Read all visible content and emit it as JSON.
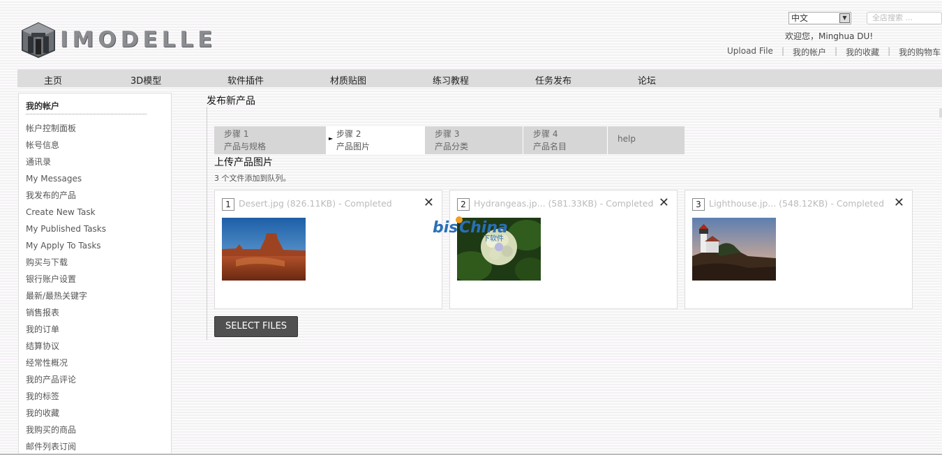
{
  "header": {
    "logo_text": "IMODELLE",
    "language": "中文",
    "search_placeholder": "全店搜索 ...",
    "welcome": "欢迎您，Minghua DU!",
    "links": [
      "Upload File",
      "我的帐户",
      "我的收藏",
      "我的购物车"
    ]
  },
  "nav": {
    "items": [
      "主页",
      "3D模型",
      "软件插件",
      "材质贴图",
      "练习教程",
      "任务发布",
      "论坛"
    ]
  },
  "sidebar": {
    "title": "我的帐户",
    "items": [
      "帐户控制面板",
      "帐号信息",
      "通讯录",
      "My Messages",
      "我发布的产品",
      "Create New Task",
      "My Published Tasks",
      "My Apply To Tasks",
      "购买与下载",
      "银行账户设置",
      "最新/最热关键字",
      "销售报表",
      "我的订单",
      "结算协议",
      "经常性概况",
      "我的产品评论",
      "我的标签",
      "我的收藏",
      "我购买的商品",
      "邮件列表订阅"
    ]
  },
  "main": {
    "title": "发布新产品",
    "steps": [
      {
        "num": "步骤 1",
        "label": "产品与规格"
      },
      {
        "num": "步骤 2",
        "label": "产品图片"
      },
      {
        "num": "步骤 3",
        "label": "产品分类"
      },
      {
        "num": "步骤 4",
        "label": "产品名目"
      }
    ],
    "help_label": "help",
    "upload_title": "上传产品图片",
    "queue_status": "3 个文件添加到队列。",
    "files": [
      {
        "index": "1",
        "name": "Desert.jpg (826.11KB) - Completed"
      },
      {
        "index": "2",
        "name": "Hydrangeas.jp... (581.33KB) - Completed"
      },
      {
        "index": "3",
        "name": "Lighthouse.jp... (548.12KB) - Completed"
      }
    ],
    "select_button": "SELECT FILES"
  },
  "watermark": {
    "text": "bisChina",
    "sub": "下软件"
  },
  "colors": {
    "nav_bg": "#dcdcdc",
    "button_bg": "#505050",
    "step_bg": "#d6d6d6",
    "watermark": "#2a6fb8"
  }
}
